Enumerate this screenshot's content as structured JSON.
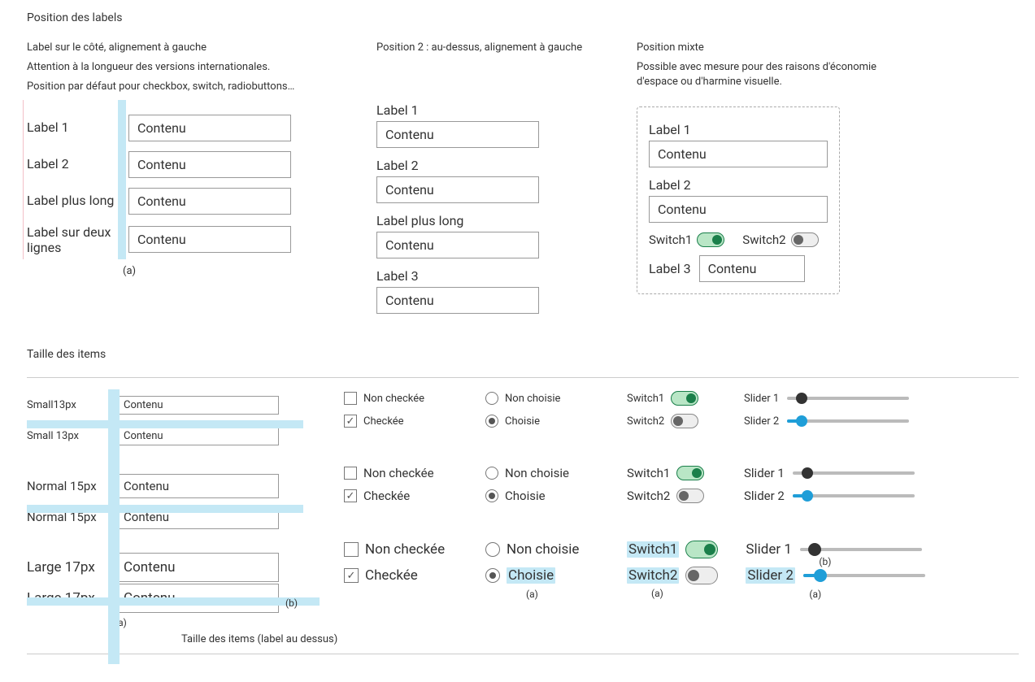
{
  "title1": "Position des labels",
  "col1": {
    "sub1": "Label sur le côté, alignement à gauche",
    "sub2": "Attention à la longueur des versions internationales.",
    "sub3": "Position par défaut pour checkbox, switch, radiobuttons…",
    "rows": [
      {
        "label": "Label 1",
        "value": "Contenu"
      },
      {
        "label": "Label 2",
        "value": "Contenu"
      },
      {
        "label": "Label plus long",
        "value": "Contenu"
      },
      {
        "label": "Label sur deux lignes",
        "value": "Contenu"
      }
    ],
    "note": "(a)"
  },
  "col2": {
    "sub": "Position 2 : au-dessus, alignement à gauche",
    "rows": [
      {
        "label": "Label 1",
        "value": "Contenu"
      },
      {
        "label": "Label 2",
        "value": "Contenu"
      },
      {
        "label": "Label plus long",
        "value": "Contenu"
      },
      {
        "label": "Label 3",
        "value": "Contenu"
      }
    ]
  },
  "col3": {
    "sub1": "Position mixte",
    "sub2": "Possible avec mesure  pour des raisons d'économie d'espace ou d'harmine visuelle.",
    "rows12": [
      {
        "label": "Label 1",
        "value": "Contenu"
      },
      {
        "label": "Label 2",
        "value": "Contenu"
      }
    ],
    "switch1_label": "Switch1",
    "switch2_label": "Switch2",
    "row3_label": "Label 3",
    "row3_value": "Contenu"
  },
  "title2": "Taille des items",
  "sizes": {
    "rows": {
      "small": {
        "label": "Small13px",
        "label2": "Small 13px",
        "value": "Contenu"
      },
      "normal": {
        "label": "Normal 15px",
        "value": "Contenu"
      },
      "large": {
        "label": "Large 17px",
        "value": "Contenu"
      }
    },
    "controls": {
      "chk_unchecked": "Non checkée",
      "chk_checked": "Checkée",
      "rdo_unchecked": "Non choisie",
      "rdo_checked": "Choisie",
      "switch1": "Switch1",
      "switch2": "Switch2",
      "slider1": "Slider 1",
      "slider2": "Slider 2"
    },
    "anno_a": "(a)",
    "anno_b": "(b)"
  },
  "footer": "Taille des items (label au dessus)"
}
